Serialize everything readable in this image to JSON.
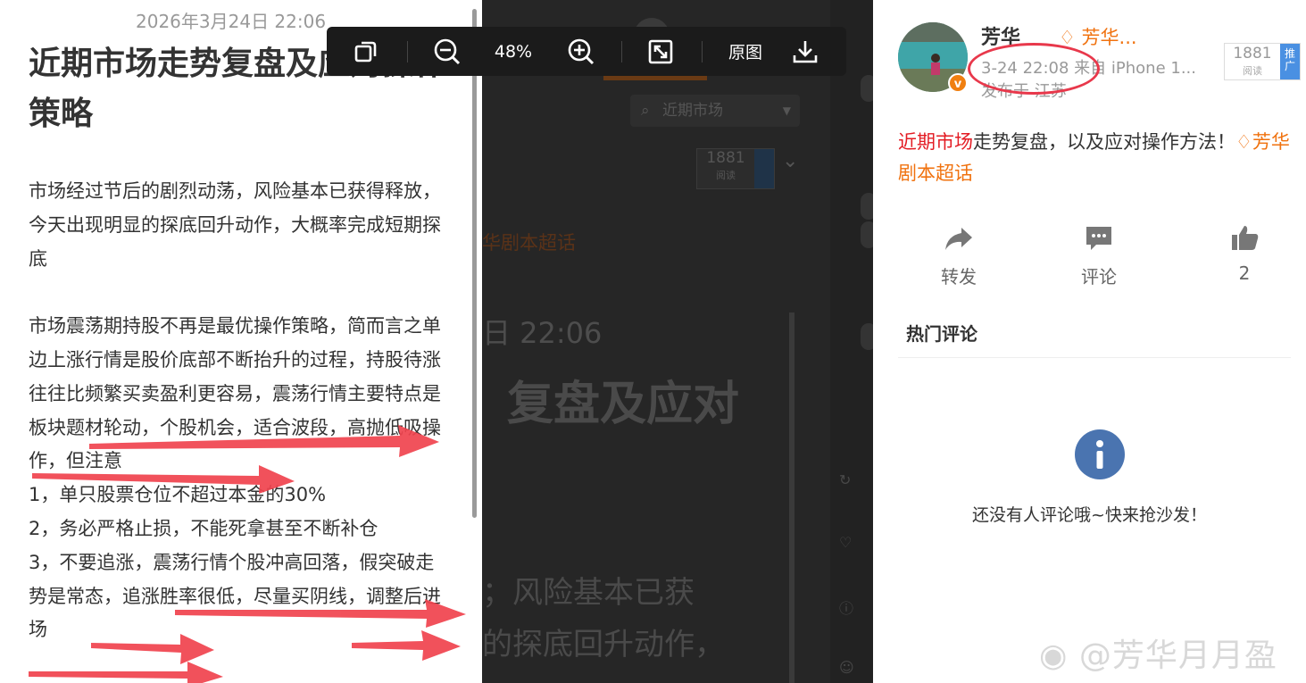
{
  "article": {
    "date": "2026年3月24日 22:06",
    "title": "近期市场走势复盘及应对操作策略",
    "paragraph1": "市场经过节后的剧烈动荡，风险基本已获得释放，今天出现明显的探底回升动作，大概率完成短期探底",
    "paragraph2": "市场震荡期持股不再是最优操作策略，简而言之单边上涨行情是股价底部不断抬升的过程，持股待涨往往比频繁买卖盈利更容易，震荡行情主要特点是板块题材轮动，个股机会，适合波段，高抛低吸操作，但注意",
    "rule1": "1，单只股票仓位不超过本金的30%",
    "rule2": "2，务必严格止损，不能死拿甚至不断补仓",
    "rule3": "3，不要追涨，震荡行情个股冲高回落，假突破走势是常态，追涨胜率很低，尽量买阴线，调整后进场"
  },
  "toolbar": {
    "zoom": "48%",
    "original_label": "原图"
  },
  "background": {
    "search_placeholder": "近期市场",
    "read_count": "1881",
    "read_label": "阅读",
    "promo": "推广",
    "topic_fragment": "华剧本超话",
    "date_fragment": "日 22:06",
    "title_fragment": "复盘及应对",
    "body_fragment1": "；风险基本已获",
    "body_fragment2": "的探底回升动作，"
  },
  "post": {
    "author": "芳华",
    "super_topic_short": "芳华...",
    "time_source": "3-24 22:08  来自 iPhone 1...",
    "location": "发布于 江苏",
    "read_count": "1881",
    "read_label": "阅读",
    "promo_label": "推广",
    "topic": "近期市场",
    "content": "走势复盘，以及应对操作方法！",
    "super_topic_full": "芳华剧本超话"
  },
  "actions": {
    "repost": "转发",
    "comment": "评论",
    "like_count": "2"
  },
  "comments": {
    "hot_title": "热门评论",
    "empty_message": "还没有人评论哦~快来抢沙发！"
  },
  "watermark": "@芳华月月盈",
  "colors": {
    "topic_red": "#e31b23",
    "super_orange": "#f0720f",
    "annotation_red": "#e8384b",
    "promo_blue": "#4a90e2",
    "info_blue": "#4a74b0"
  }
}
